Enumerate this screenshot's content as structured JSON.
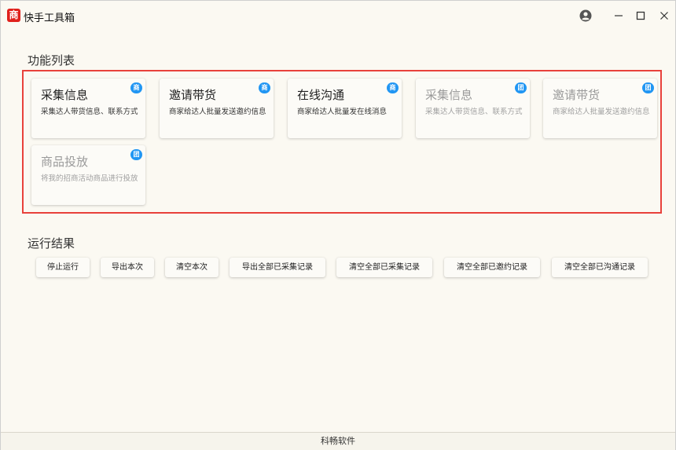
{
  "app": {
    "logo_char": "商",
    "title": "快手工具箱"
  },
  "functions": {
    "section_title": "功能列表",
    "cards": [
      {
        "title": "采集信息",
        "desc": "采集达人带货信息、联系方式",
        "badge": "商",
        "enabled": true
      },
      {
        "title": "邀请带货",
        "desc": "商家给达人批量发送邀约信息",
        "badge": "商",
        "enabled": true
      },
      {
        "title": "在线沟通",
        "desc": "商家给达人批量发在线消息",
        "badge": "商",
        "enabled": true
      },
      {
        "title": "采集信息",
        "desc": "采集达人带货信息、联系方式",
        "badge": "团",
        "enabled": false
      },
      {
        "title": "邀请带货",
        "desc": "商家给达人批量发送邀约信息",
        "badge": "团",
        "enabled": false
      },
      {
        "title": "商品投放",
        "desc": "将我的招商活动商品进行投放",
        "badge": "团",
        "enabled": false
      }
    ]
  },
  "results": {
    "section_title": "运行结果",
    "buttons": [
      "停止运行",
      "导出本次",
      "清空本次",
      "导出全部已采集记录",
      "清空全部已采集记录",
      "清空全部已邀约记录",
      "清空全部已沟通记录"
    ]
  },
  "footer": {
    "text": "科畅软件"
  },
  "colors": {
    "accent_badge": "#2196f3",
    "panel_border": "#e8413b",
    "logo": "#e0211c"
  }
}
